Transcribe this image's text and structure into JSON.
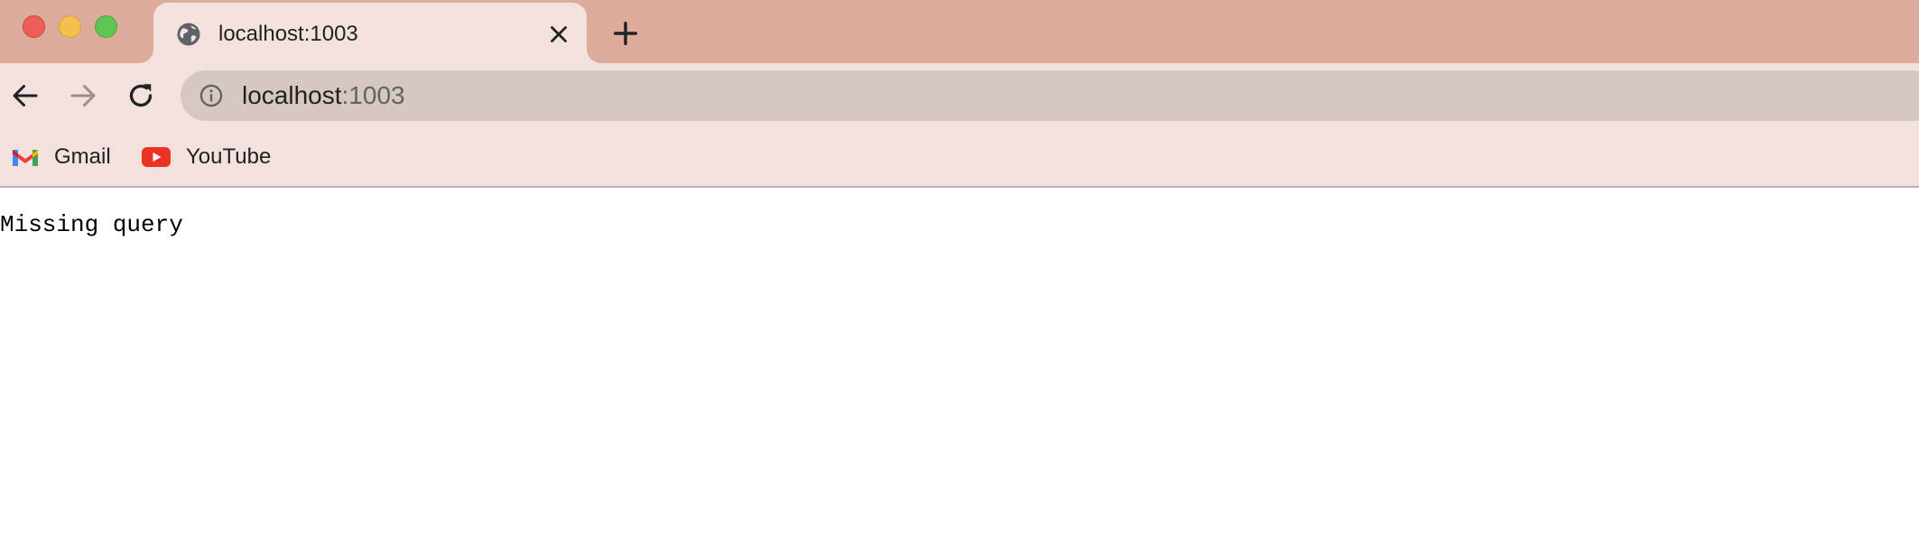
{
  "window": {
    "traffic_lights": {
      "close_color": "#ec5f57",
      "minimize_color": "#f4bf4f",
      "maximize_color": "#61c554"
    }
  },
  "theme": {
    "tabstrip_color": "#dcab9c",
    "chrome_color": "#f2e1dc",
    "omnibox_color": "#d6c7c1"
  },
  "tab": {
    "title": "localhost:1003",
    "favicon": "globe-icon",
    "close_icon": "close-icon"
  },
  "new_tab_icon": "plus-icon",
  "toolbar": {
    "back_icon": "arrow-left-icon",
    "forward_icon": "arrow-right-icon",
    "reload_icon": "reload-icon"
  },
  "omnibox": {
    "info_icon": "info-icon",
    "url_host": "localhost",
    "url_port": ":1003"
  },
  "bookmarks": [
    {
      "label": "Gmail",
      "icon": "gmail-icon"
    },
    {
      "label": "YouTube",
      "icon": "youtube-icon"
    }
  ],
  "page": {
    "message": "Missing query"
  }
}
